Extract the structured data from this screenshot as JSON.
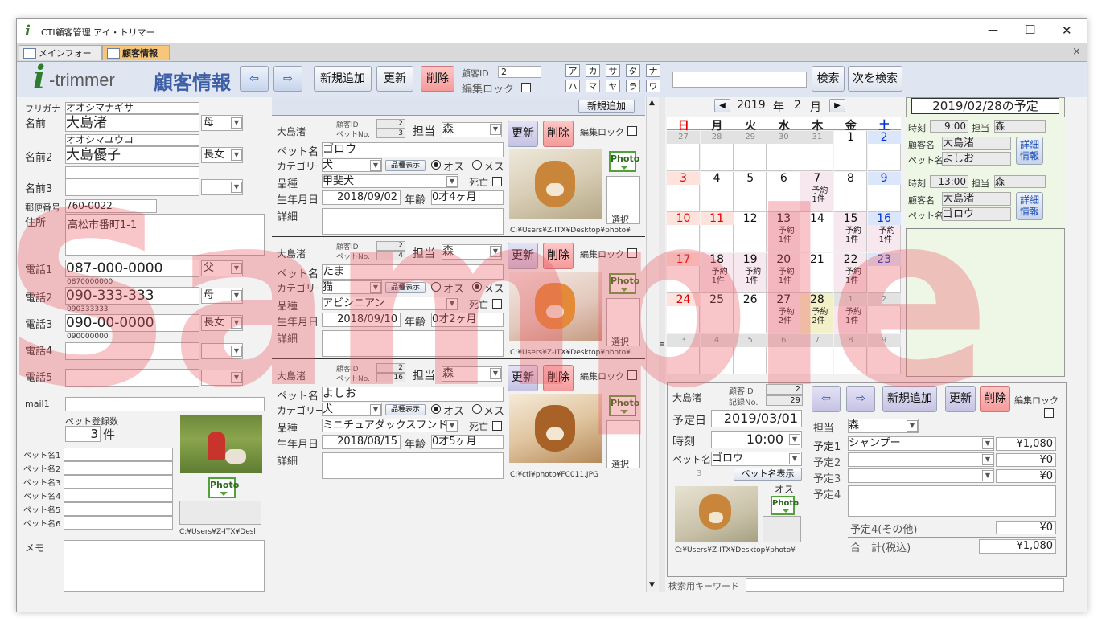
{
  "window": {
    "title": "CTI顧客管理 アイ・トリマー",
    "minimize": "—",
    "maximize": "☐",
    "close": "✕"
  },
  "tabs": [
    {
      "label": "メインフォーム"
    },
    {
      "label": "顧客情報"
    }
  ],
  "tabs_close": "×",
  "header": {
    "logo_i": "i",
    "logo_text": "-trimmer",
    "title": "顧客情報",
    "prev": "⇦",
    "next": "⇨",
    "new_button": "新規追加",
    "update_button": "更新",
    "delete_button": "削除",
    "customer_id_label": "顧客ID",
    "customer_id": "2",
    "edit_lock_label": "編集ロック",
    "kana_row1": [
      "ア",
      "カ",
      "サ",
      "タ",
      "ナ"
    ],
    "kana_row2": [
      "ハ",
      "マ",
      "ヤ",
      "ラ",
      "ワ"
    ],
    "search_value": "",
    "search_button": "検索",
    "next_search_button": "次を検索"
  },
  "left": {
    "furigana_label": "フリガナ",
    "furigana": "オオシマナギサ",
    "name_label": "名前",
    "name": "大島渚",
    "name_rel": "母",
    "furigana2": "オオシマユウコ",
    "name2_label": "名前2",
    "name2": "大島優子",
    "name2_rel": "長女",
    "name3_label": "名前3",
    "postal_label": "郵便番号",
    "postal": "760-0022",
    "address_label": "住所",
    "address": "高松市番町1-1",
    "phones": [
      {
        "label": "電話1",
        "value": "087-000-0000",
        "rel": "父",
        "digits": "0870000000"
      },
      {
        "label": "電話2",
        "value": "090-333-333",
        "rel": "母",
        "digits": "090333333"
      },
      {
        "label": "電話3",
        "value": "090-00-0000",
        "rel": "長女",
        "digits": "090000000"
      },
      {
        "label": "電話4",
        "value": "",
        "rel": "",
        "digits": ""
      },
      {
        "label": "電話5",
        "value": "",
        "rel": "",
        "digits": ""
      }
    ],
    "mail_label": "mail1",
    "pet_count_label": "ペット登録数",
    "pet_count": "3",
    "pet_count_unit": "件",
    "pet_names": [
      "ペット名1",
      "ペット名2",
      "ペット名3",
      "ペット名4",
      "ペット名5",
      "ペット名6"
    ],
    "photo_button": "Photo",
    "photo_path": "C:¥Users¥Z-ITX¥Desl",
    "memo_label": "メモ"
  },
  "pets": {
    "new_button": "新規追加",
    "owner_label": "大島渚",
    "cust_id_label": "顧客ID",
    "pet_no_label": "ペットNo.",
    "staff_label": "担当",
    "update": "更新",
    "delete": "削除",
    "edit_lock": "編集ロック",
    "pet_name_label": "ペット名",
    "category_label": "カテゴリー",
    "breed_btn": "品種表示",
    "male": "オス",
    "female": "メス",
    "breed_label": "品種",
    "dead_label": "死亡",
    "birth_label": "生年月日",
    "age_label": "年齢",
    "detail_label": "詳細",
    "select_label": "選択",
    "photo_button": "Photo",
    "items": [
      {
        "cust_id": "2",
        "pet_no": "3",
        "staff": "森",
        "name": "ゴロウ",
        "category": "犬",
        "sex": "male",
        "breed": "甲斐犬",
        "birth": "2018/09/02",
        "age": "0才4ヶ月",
        "path": "C:¥Users¥Z-ITX¥Desktop¥photo¥"
      },
      {
        "cust_id": "2",
        "pet_no": "4",
        "staff": "森",
        "name": "たま",
        "category": "猫",
        "sex": "female",
        "breed": "アビシニアン",
        "birth": "2018/09/10",
        "age": "0才2ヶ月",
        "path": "C:¥Users¥Z-ITX¥Desktop¥photo¥"
      },
      {
        "cust_id": "2",
        "pet_no": "16",
        "staff": "森",
        "name": "よしお",
        "category": "犬",
        "sex": "male",
        "breed": "ミニチュアダックスフンド",
        "birth": "2018/08/15",
        "age": "0才5ヶ月",
        "path": "C:¥cti¥photo¥FC011.JPG"
      }
    ]
  },
  "calendar": {
    "year": "2019",
    "year_unit": "年",
    "month": "2",
    "month_unit": "月",
    "prev": "◀",
    "next": "▶",
    "weekdays": [
      "日",
      "月",
      "火",
      "水",
      "木",
      "金",
      "土"
    ],
    "weeks": [
      [
        {
          "d": "27",
          "o": true
        },
        {
          "d": "28",
          "o": true
        },
        {
          "d": "29",
          "o": true
        },
        {
          "d": "30",
          "o": true
        },
        {
          "d": "31",
          "o": true
        },
        {
          "d": "1"
        },
        {
          "d": "2"
        }
      ],
      [
        {
          "d": "3"
        },
        {
          "d": "4"
        },
        {
          "d": "5"
        },
        {
          "d": "6"
        },
        {
          "d": "7",
          "e": "予約\n1件"
        },
        {
          "d": "8"
        },
        {
          "d": "9"
        }
      ],
      [
        {
          "d": "10"
        },
        {
          "d": "11"
        },
        {
          "d": "12"
        },
        {
          "d": "13",
          "e": "予約\n1件"
        },
        {
          "d": "14"
        },
        {
          "d": "15",
          "e": "予約\n1件"
        },
        {
          "d": "16",
          "e": "予約\n1件"
        }
      ],
      [
        {
          "d": "17"
        },
        {
          "d": "18",
          "e": "予約\n1件"
        },
        {
          "d": "19",
          "e": "予約\n1件"
        },
        {
          "d": "20",
          "e": "予約\n1件"
        },
        {
          "d": "21"
        },
        {
          "d": "22",
          "e": "予約\n1件"
        },
        {
          "d": "23"
        }
      ],
      [
        {
          "d": "24"
        },
        {
          "d": "25"
        },
        {
          "d": "26"
        },
        {
          "d": "27",
          "e": "予約\n2件"
        },
        {
          "d": "28",
          "e": "予約\n2件"
        },
        {
          "d": "1",
          "o": true,
          "e": "予約\n1件"
        },
        {
          "d": "2",
          "o": true
        }
      ],
      [
        {
          "d": "3",
          "o": true
        },
        {
          "d": "4",
          "o": true
        },
        {
          "d": "5",
          "o": true
        },
        {
          "d": "6",
          "o": true
        },
        {
          "d": "7",
          "o": true
        },
        {
          "d": "8",
          "o": true
        },
        {
          "d": "9",
          "o": true
        }
      ]
    ]
  },
  "schedule": {
    "title": "2019/02/28の予定",
    "time_label": "時刻",
    "staff_label": "担当",
    "customer_label": "顧客名",
    "pet_label": "ペット名",
    "detail_button": "詳細\n情報",
    "items": [
      {
        "time": "9:00",
        "staff": "森",
        "customer": "大島渚",
        "pet": "よしお"
      },
      {
        "time": "13:00",
        "staff": "森",
        "customer": "大島渚",
        "pet": "ゴロウ"
      }
    ]
  },
  "reservation": {
    "owner": "大島渚",
    "cust_id_label": "顧客ID",
    "cust_id": "2",
    "record_label": "記録No.",
    "record_no": "29",
    "prev": "⇦",
    "next": "⇨",
    "new_button": "新規追加",
    "update_button": "更新",
    "delete_button": "削除",
    "edit_lock_label": "編集ロック",
    "date_label": "予定日",
    "date": "2019/03/01",
    "time_label": "時刻",
    "time": "10:00",
    "pet_label": "ペット名",
    "pet": "ゴロウ",
    "pet_no": "3",
    "pet_show_button": "ペット名表示",
    "sex": "オス",
    "photo_button": "Photo",
    "photo_path": "C:¥Users¥Z-ITX¥Desktop¥photo¥",
    "staff_label": "担当",
    "staff": "森",
    "plans": [
      {
        "label": "予定1",
        "value": "シャンプー",
        "amount": "¥1,080"
      },
      {
        "label": "予定2",
        "value": "",
        "amount": "¥0"
      },
      {
        "label": "予定3",
        "value": "",
        "amount": "¥0"
      }
    ],
    "plan4_label": "予定4",
    "plan4_other_label": "予定4(その他)",
    "plan4_other_amount": "¥0",
    "total_label": "合　計(税込)",
    "total": "¥1,080"
  },
  "keyword_label": "検索用キーワード",
  "watermark": "Sample",
  "colors": {
    "header_bg": "#dfe6f1",
    "tab_active": "#f6c77a",
    "sunday": "#e00000",
    "saturday": "#0033cc",
    "delete_button": "#f59a9a",
    "schedule_bg": "#eef7e6",
    "photo_green": "#52a23a"
  }
}
